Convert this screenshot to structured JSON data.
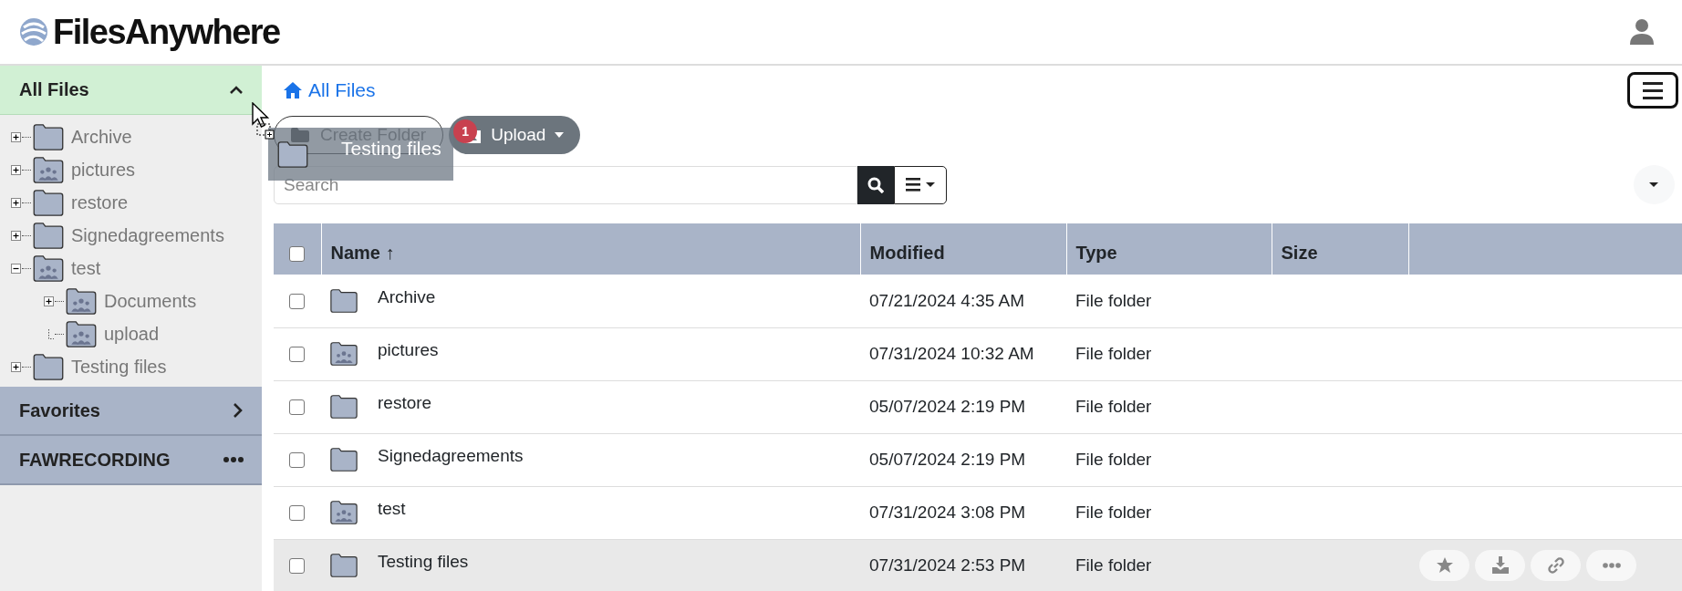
{
  "header": {
    "logo": "FilesAnywhere"
  },
  "sidebar": {
    "sections": [
      {
        "label": "All Files",
        "kind": "collapsible",
        "expanded": true,
        "selected": true,
        "tree": [
          {
            "label": "Archive",
            "kind": "plain",
            "expandable": true,
            "expanded": false
          },
          {
            "label": "pictures",
            "kind": "shared",
            "expandable": true,
            "expanded": false
          },
          {
            "label": "restore",
            "kind": "plain",
            "expandable": true,
            "expanded": false
          },
          {
            "label": "Signedagreements",
            "kind": "plain",
            "expandable": true,
            "expanded": false
          },
          {
            "label": "test",
            "kind": "shared",
            "expandable": true,
            "expanded": true,
            "children": [
              {
                "label": "Documents",
                "kind": "shared",
                "expandable": true,
                "expanded": false
              },
              {
                "label": "upload",
                "kind": "shared",
                "expandable": false
              }
            ]
          },
          {
            "label": "Testing files",
            "kind": "plain",
            "expandable": true,
            "expanded": false
          }
        ]
      },
      {
        "label": "Favorites",
        "kind": "collapsible",
        "expanded": false,
        "selected": false
      },
      {
        "label": "FAWRECORDING",
        "kind": "menu",
        "selected": false
      }
    ]
  },
  "breadcrumb": {
    "label": "All Files"
  },
  "toolbar": {
    "create_folder": "Create Folder",
    "upload": "Upload",
    "upload_badge": "1"
  },
  "search": {
    "placeholder": "Search"
  },
  "drag_ghost": {
    "label": "Testing files"
  },
  "table": {
    "select_all_checked": false,
    "columns": [
      "Name ↑",
      "Modified",
      "Type",
      "Size"
    ],
    "rows": [
      {
        "name": "Archive",
        "kind": "plain",
        "modified": "07/21/2024 4:35 AM",
        "type": "File folder",
        "checked": false,
        "hovered": false
      },
      {
        "name": "pictures",
        "kind": "shared",
        "modified": "07/31/2024 10:32 AM",
        "type": "File folder",
        "checked": false,
        "hovered": false
      },
      {
        "name": "restore",
        "kind": "plain",
        "modified": "05/07/2024 2:19 PM",
        "type": "File folder",
        "checked": false,
        "hovered": false
      },
      {
        "name": "Signedagreements",
        "kind": "plain",
        "modified": "05/07/2024 2:19 PM",
        "type": "File folder",
        "checked": false,
        "hovered": false
      },
      {
        "name": "test",
        "kind": "shared",
        "modified": "07/31/2024 3:08 PM",
        "type": "File folder",
        "checked": false,
        "hovered": false
      },
      {
        "name": "Testing files",
        "kind": "plain",
        "modified": "07/31/2024 2:53 PM",
        "type": "File folder",
        "checked": false,
        "hovered": true
      }
    ]
  }
}
